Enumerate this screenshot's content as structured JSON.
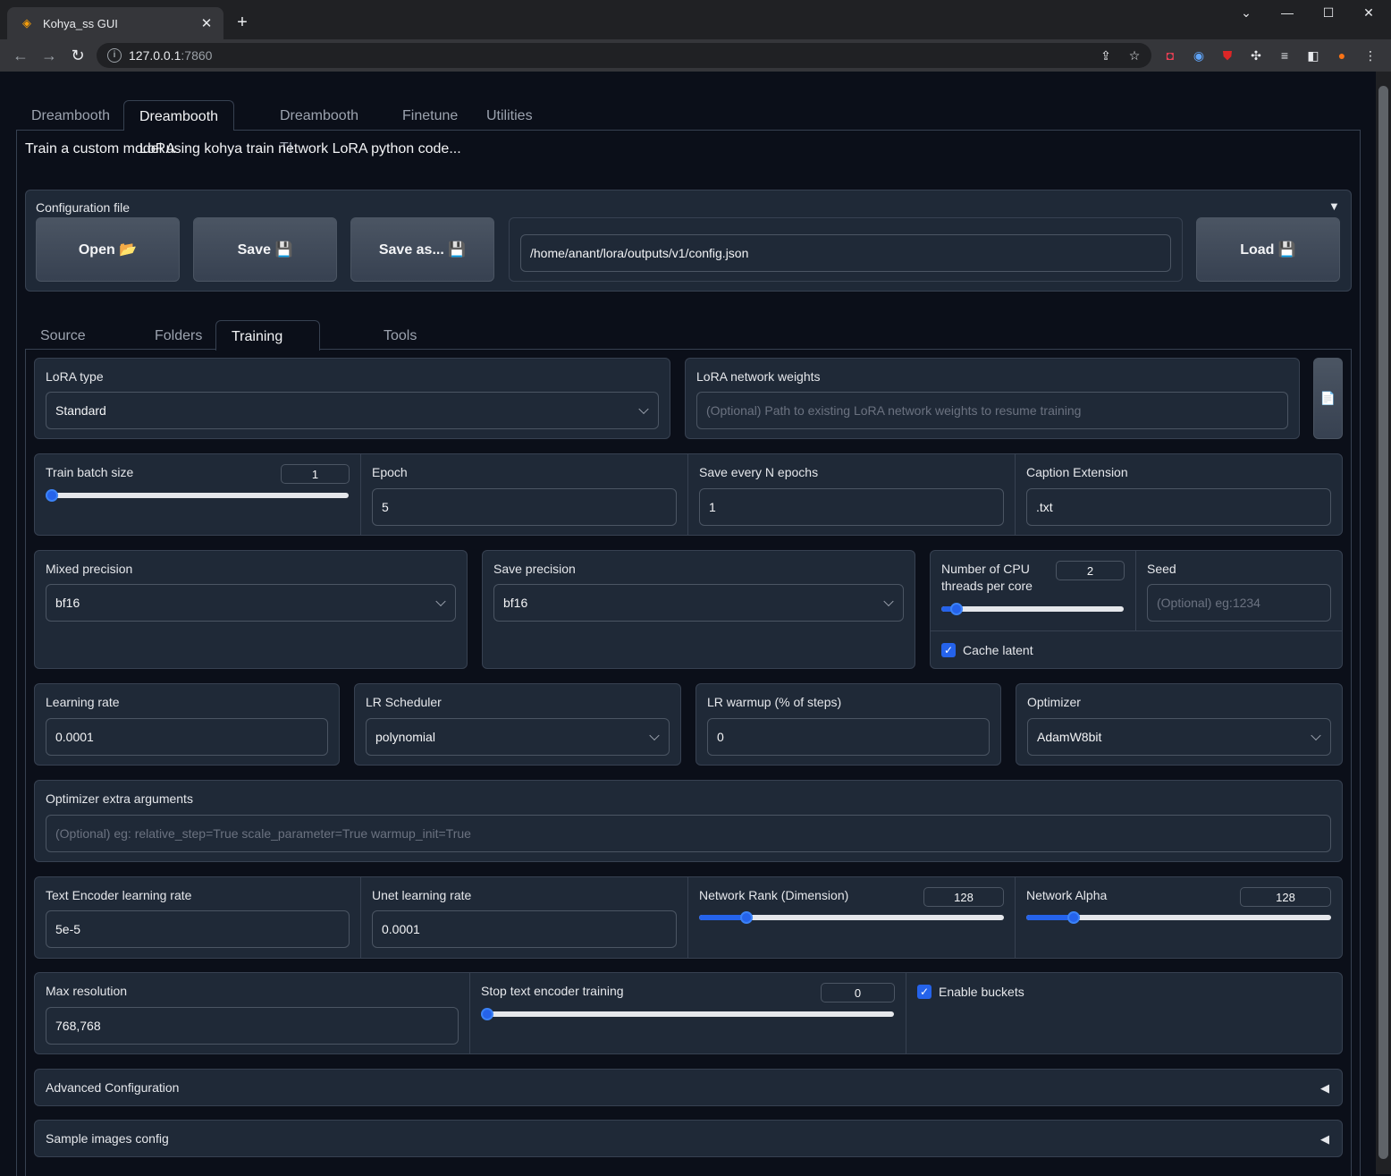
{
  "browser": {
    "tab_title": "Kohya_ss GUI",
    "url_host": "127.0.0.1",
    "url_port": ":7860"
  },
  "top_tabs": [
    "Dreambooth",
    "Dreambooth LoRA",
    "Dreambooth TI",
    "Finetune",
    "Utilities"
  ],
  "description": "Train a custom model using kohya train network LoRA python code...",
  "config": {
    "label": "Configuration file",
    "open": "Open 📂",
    "save": "Save 💾",
    "save_as": "Save as... 💾",
    "path": "/home/anant/lora/outputs/v1/config.json",
    "load": "Load 💾"
  },
  "sub_tabs": [
    "Source model",
    "Folders",
    "Training parameters",
    "Tools"
  ],
  "params": {
    "lora_type_label": "LoRA type",
    "lora_type_value": "Standard",
    "lora_weights_label": "LoRA network weights",
    "lora_weights_placeholder": "(Optional) Path to existing LoRA network weights to resume training",
    "file_icon": "📄",
    "train_batch_label": "Train batch size",
    "train_batch_value": "1",
    "epoch_label": "Epoch",
    "epoch_value": "5",
    "save_every_label": "Save every N epochs",
    "save_every_value": "1",
    "caption_ext_label": "Caption Extension",
    "caption_ext_value": ".txt",
    "mixed_precision_label": "Mixed precision",
    "mixed_precision_value": "bf16",
    "save_precision_label": "Save precision",
    "save_precision_value": "bf16",
    "cpu_threads_label_1": "Number of CPU",
    "cpu_threads_label_2": "threads per core",
    "cpu_threads_value": "2",
    "seed_label": "Seed",
    "seed_placeholder": "(Optional) eg:1234",
    "cache_latent_label": "Cache latent",
    "learning_rate_label": "Learning rate",
    "learning_rate_value": "0.0001",
    "lr_scheduler_label": "LR Scheduler",
    "lr_scheduler_value": "polynomial",
    "lr_warmup_label": "LR warmup (% of steps)",
    "lr_warmup_value": "0",
    "optimizer_label": "Optimizer",
    "optimizer_value": "AdamW8bit",
    "opt_extra_label": "Optimizer extra arguments",
    "opt_extra_placeholder": "(Optional) eg: relative_step=True scale_parameter=True warmup_init=True",
    "te_lr_label": "Text Encoder learning rate",
    "te_lr_value": "5e-5",
    "unet_lr_label": "Unet learning rate",
    "unet_lr_value": "0.0001",
    "net_rank_label": "Network Rank (Dimension)",
    "net_rank_value": "128",
    "net_alpha_label": "Network Alpha",
    "net_alpha_value": "128",
    "max_res_label": "Max resolution",
    "max_res_value": "768,768",
    "stop_te_label": "Stop text encoder training",
    "stop_te_value": "0",
    "enable_buckets_label": "Enable buckets",
    "advanced_label": "Advanced Configuration",
    "sample_label": "Sample images config"
  },
  "slider_levels": {
    "train_batch": 0.0,
    "cpu_threads": 0.05,
    "net_rank": 0.14,
    "net_alpha": 0.14,
    "stop_te": 0.0
  },
  "colors": {
    "accent": "#2563eb",
    "bg": "#0b0f19",
    "panel": "#1f2937"
  }
}
